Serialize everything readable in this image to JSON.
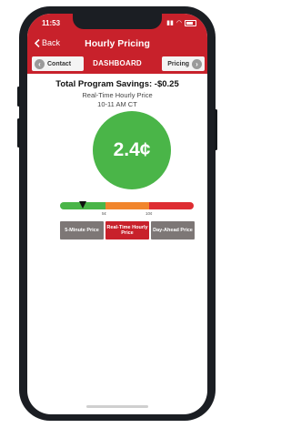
{
  "status_bar": {
    "time": "11:53"
  },
  "nav": {
    "back_label": "Back",
    "title": "Hourly Pricing"
  },
  "dashboard_bar": {
    "title": "DASHBOARD",
    "left_button": {
      "label": "Contact",
      "icon": "arrow-left-circle-icon"
    },
    "right_button": {
      "label": "Pricing",
      "icon": "arrow-right-circle-icon"
    }
  },
  "summary": {
    "savings_label": "Total Program Savings: -$0.25",
    "price_label": "Real-Time Hourly Price",
    "time_range": "10-11 AM CT"
  },
  "current_price": {
    "value": "2.4¢",
    "color": "#4ab548"
  },
  "scale": {
    "ticks": [
      "5¢",
      "10¢"
    ],
    "colors": [
      "#4ab548",
      "#f1852c",
      "#de2d32"
    ],
    "marker_value_cents": 2.4
  },
  "price_tabs": [
    {
      "label": "5-Minute Price",
      "active": false
    },
    {
      "label": "Real-Time Hourly Price",
      "active": true
    },
    {
      "label": "Day-Ahead Price",
      "active": false
    }
  ],
  "colors": {
    "brand_red": "#c8212b",
    "tab_gray": "#7d7776"
  }
}
